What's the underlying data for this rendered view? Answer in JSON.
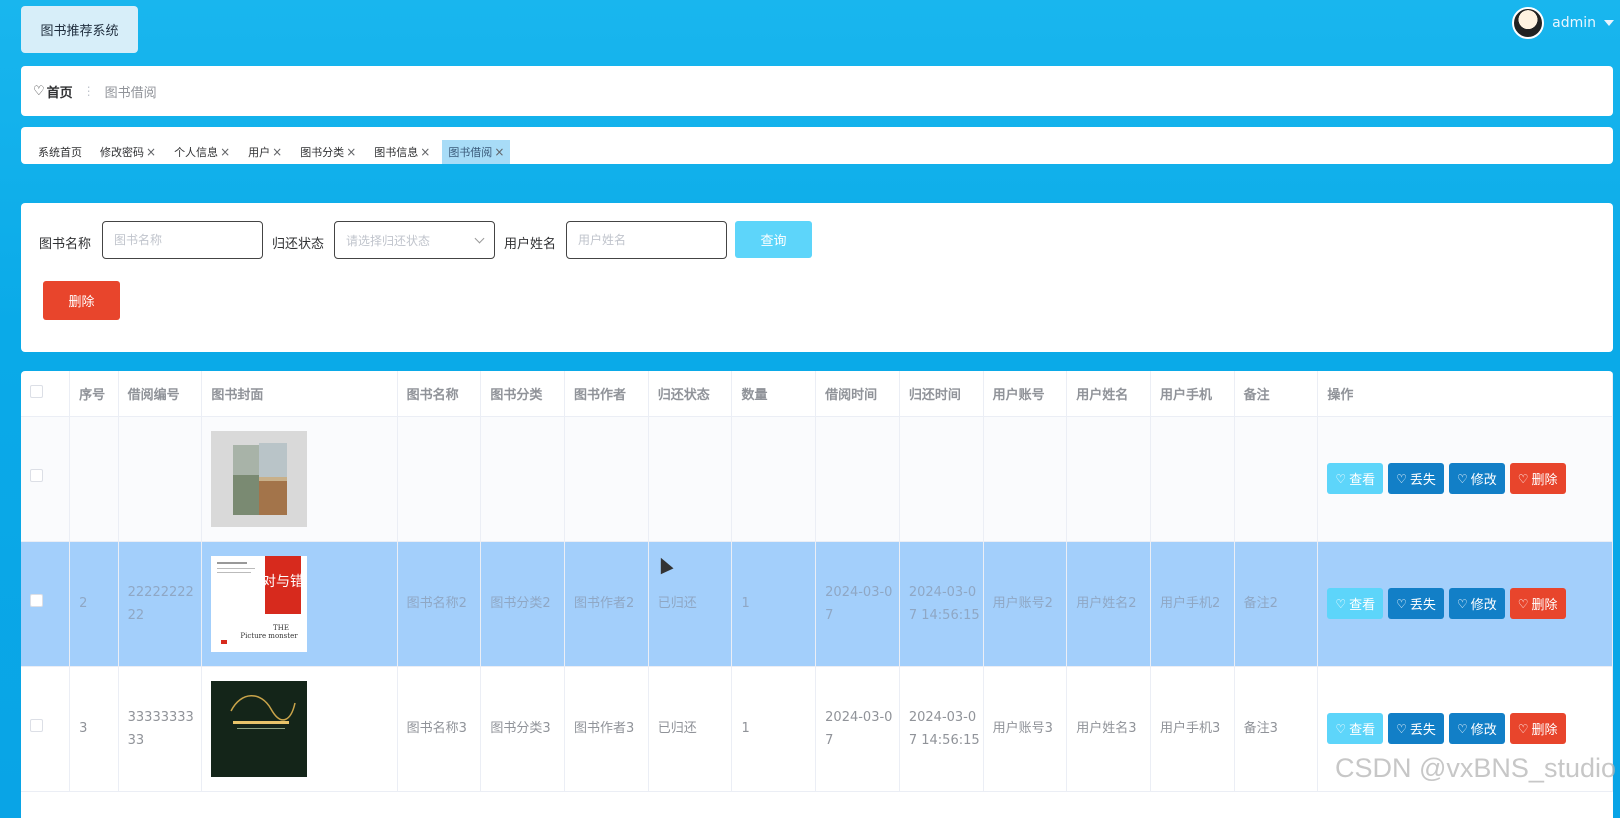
{
  "app": {
    "title": "图书推荐系统"
  },
  "user": {
    "name": "admin"
  },
  "breadcrumb": {
    "home": "首页",
    "current": "图书借阅"
  },
  "tabs": [
    {
      "label": "系统首页",
      "closable": false
    },
    {
      "label": "修改密码",
      "closable": true
    },
    {
      "label": "个人信息",
      "closable": true
    },
    {
      "label": "用户",
      "closable": true
    },
    {
      "label": "图书分类",
      "closable": true
    },
    {
      "label": "图书信息",
      "closable": true
    },
    {
      "label": "图书借阅",
      "closable": true,
      "active": true
    }
  ],
  "tab_close": "×",
  "search": {
    "book_name_label": "图书名称",
    "book_name_placeholder": "图书名称",
    "return_status_label": "归还状态",
    "return_status_placeholder": "请选择归还状态",
    "user_name_label": "用户姓名",
    "user_name_placeholder": "用户姓名",
    "query_label": "查询",
    "delete_label": "删除"
  },
  "table": {
    "headers": [
      "序号",
      "借阅编号",
      "图书封面",
      "图书名称",
      "图书分类",
      "图书作者",
      "归还状态",
      "数量",
      "借阅时间",
      "归还时间",
      "用户账号",
      "用户姓名",
      "用户手机",
      "备注",
      "操作"
    ],
    "rows": [
      {
        "index": "",
        "borrow_no": "",
        "book_name": "",
        "category": "",
        "author": "",
        "status": "",
        "qty": "",
        "borrow_time": "",
        "return_time": "",
        "account": "",
        "user_name": "",
        "phone": "",
        "remark": ""
      },
      {
        "index": "2",
        "borrow_no": "2222222222",
        "book_name": "图书名称2",
        "category": "图书分类2",
        "author": "图书作者2",
        "status": "已归还",
        "qty": "1",
        "borrow_time": "2024-03-07",
        "return_time": "2024-03-07 14:56:15",
        "account": "用户账号2",
        "user_name": "用户姓名2",
        "phone": "用户手机2",
        "remark": "备注2"
      },
      {
        "index": "3",
        "borrow_no": "3333333333",
        "book_name": "图书名称3",
        "category": "图书分类3",
        "author": "图书作者3",
        "status": "已归还",
        "qty": "1",
        "borrow_time": "2024-03-07",
        "return_time": "2024-03-07 14:56:15",
        "account": "用户账号3",
        "user_name": "用户姓名3",
        "phone": "用户手机3",
        "remark": "备注3"
      }
    ],
    "actions": {
      "view": "查看",
      "lost": "丢失",
      "edit": "修改",
      "delete": "删除"
    }
  },
  "cover_text": {
    "book2_title": "对与错",
    "book2_subtitle_1": "THE",
    "book2_subtitle_2": "Picture monster"
  },
  "watermark": "CSDN @vxBNS_studio",
  "colors": {
    "primary": "#127fc7",
    "info": "#5dd5fa",
    "danger": "#e8452c",
    "row_highlight": "#a3cffb"
  }
}
